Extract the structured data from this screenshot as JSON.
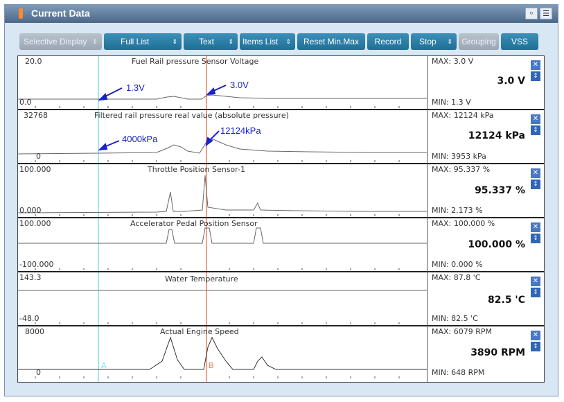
{
  "window": {
    "title": "Current Data"
  },
  "toolbar": {
    "buttons": [
      {
        "label": "Selective Display",
        "disabled": true
      },
      {
        "label": "Full List"
      },
      {
        "label": "Text"
      },
      {
        "label": "Items List"
      },
      {
        "label": "Reset Min.Max"
      },
      {
        "label": "Record"
      },
      {
        "label": "Stop"
      },
      {
        "label": "Grouping",
        "disabled": true
      },
      {
        "label": "VSS"
      }
    ]
  },
  "cursors": {
    "a_label": "A",
    "b_label": "B"
  },
  "rows": [
    {
      "name": "Fuel Rail pressure Sensor Voltage",
      "top_scale": "20.0",
      "bottom_scale": "0.0",
      "max": "MAX:   3.0 V",
      "min": "MIN:   1.3 V",
      "current": "3.0 V",
      "anno_a": "1.3V",
      "anno_b": "3.0V"
    },
    {
      "name": "Filtered rail pressure real value (absolute pressure)",
      "top_scale": "32768",
      "bottom_scale": "0",
      "max": "MAX: 12124 kPa",
      "min": "MIN:  3953 kPa",
      "current": "12124 kPa",
      "anno_a": "4000kPa",
      "anno_b": "12124kPa"
    },
    {
      "name": "Throttle Position Sensor-1",
      "top_scale": "100.000",
      "bottom_scale": "0.000",
      "max": "MAX: 95.337 %",
      "min": "MIN: 2.173 %",
      "current": "95.337 %"
    },
    {
      "name": "Accelerator Pedal Position Sensor",
      "top_scale": "100.000",
      "bottom_scale": "-100.000",
      "max": "MAX: 100.000 %",
      "min": "MIN: 0.000 %",
      "current": "100.000 %"
    },
    {
      "name": "Water Temperature",
      "top_scale": "143.3",
      "bottom_scale": "-48.0",
      "max": "MAX:  87.8 'C",
      "min": "MIN:  82.5 'C",
      "current": "82.5 'C"
    },
    {
      "name": "Actual Engine Speed",
      "top_scale": "8000",
      "bottom_scale": "0",
      "max": "MAX:  6079 RPM",
      "min": "MIN:   648 RPM",
      "current": "3890 RPM"
    }
  ],
  "icons": {
    "close": "close-icon",
    "reorder": "reorder-icon",
    "retry": "retry-icon",
    "menu": "menu-icon"
  }
}
